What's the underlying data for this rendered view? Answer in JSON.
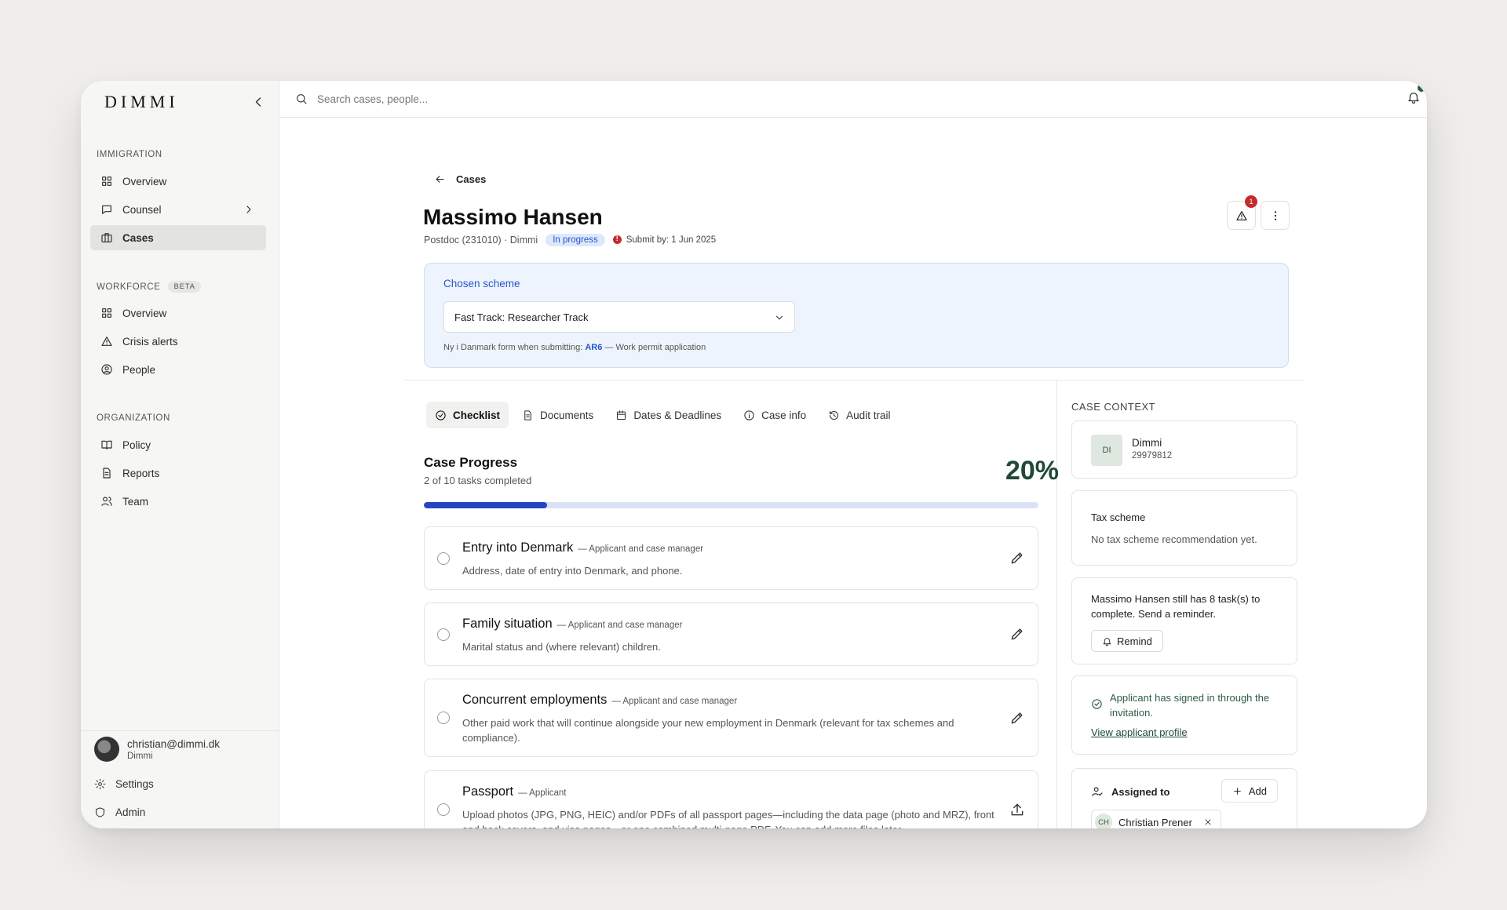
{
  "app": {
    "logo": "DIMMI"
  },
  "sidebar": {
    "sections": {
      "immigration": "IMMIGRATION",
      "workforce": "WORKFORCE",
      "workforce_badge": "BETA",
      "organization": "ORGANIZATION"
    },
    "items": [
      {
        "label": "Overview",
        "icon": "grid-icon"
      },
      {
        "label": "Counsel",
        "icon": "chat-icon"
      },
      {
        "label": "Cases",
        "icon": "briefcase-icon",
        "active": true
      },
      {
        "label": "Overview",
        "icon": "grid-icon"
      },
      {
        "label": "Crisis alerts",
        "icon": "warning-icon"
      },
      {
        "label": "People",
        "icon": "person-circle-icon"
      },
      {
        "label": "Policy",
        "icon": "book-icon"
      },
      {
        "label": "Reports",
        "icon": "document-icon"
      },
      {
        "label": "Team",
        "icon": "users-icon"
      }
    ],
    "user": {
      "email": "christian@dimmi.dk",
      "org": "Dimmi"
    },
    "settings_label": "Settings",
    "admin_label": "Admin"
  },
  "search": {
    "placeholder": "Search cases, people..."
  },
  "case": {
    "back_label": "Cases",
    "name": "Massimo Hansen",
    "meta": "Postdoc (231010) · Dimmi",
    "status": "In progress",
    "submit_by": "Submit by: 1 Jun 2025",
    "alert_count": "1"
  },
  "scheme": {
    "label": "Chosen scheme",
    "selected": "Fast Track: Researcher Track",
    "note_prefix": "Ny i Danmark form when submitting: ",
    "note_form": "AR6",
    "note_suffix": " — Work permit application"
  },
  "tabs": [
    {
      "label": "Checklist",
      "icon": "check-circle-icon",
      "active": true
    },
    {
      "label": "Documents",
      "icon": "document-icon"
    },
    {
      "label": "Dates & Deadlines",
      "icon": "calendar-icon"
    },
    {
      "label": "Case info",
      "icon": "info-icon"
    },
    {
      "label": "Audit trail",
      "icon": "history-icon"
    }
  ],
  "progress": {
    "title": "Case Progress",
    "subtitle": "2 of 10 tasks completed",
    "percent_label": "20%",
    "fraction": 0.2
  },
  "tasks": [
    {
      "name": "Entry into Denmark",
      "role": "— Applicant and case manager",
      "desc": "Address, date of entry into Denmark, and phone.",
      "action": "edit-icon"
    },
    {
      "name": "Family situation",
      "role": "— Applicant and case manager",
      "desc": "Marital status and (where relevant) children.",
      "action": "edit-icon"
    },
    {
      "name": "Concurrent employments",
      "role": "— Applicant and case manager",
      "desc": "Other paid work that will continue alongside your new employment in Denmark (relevant for tax schemes and compliance).",
      "action": "edit-icon"
    },
    {
      "name": "Passport",
      "role": "— Applicant",
      "desc": "Upload photos (JPG, PNG, HEIC) and/or PDFs of all passport pages—including the data page (photo and MRZ), front and back covers, and visa pages—or one combined multi-page PDF. You can add more files later.",
      "action": "upload-icon"
    }
  ],
  "context": {
    "title": "CASE CONTEXT",
    "org": {
      "initials": "DI",
      "name": "Dimmi",
      "id": "29979812"
    },
    "tax": {
      "title": "Tax scheme",
      "text": "No tax scheme recommendation yet."
    },
    "reminder": {
      "text": "Massimo Hansen still has 8 task(s) to complete. Send a reminder.",
      "button": "Remind"
    },
    "signed": {
      "text": "Applicant has signed in through the invitation.",
      "link": "View applicant profile"
    },
    "assigned": {
      "title": "Assigned to",
      "add": "Add",
      "assignee_initials": "CH",
      "assignee_name": "Christian Prener"
    }
  }
}
